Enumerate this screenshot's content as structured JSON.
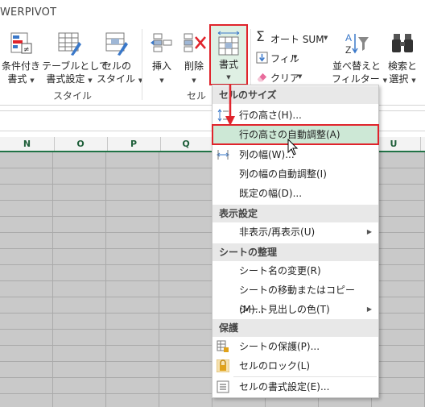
{
  "ribbon": {
    "tab_title": "WERPIVOT",
    "cond_format": {
      "line1": "条件付き",
      "line2": "書式"
    },
    "table_format": {
      "line1": "テーブルとして",
      "line2": "書式設定"
    },
    "cell_style": {
      "line1": "セルの",
      "line2": "スタイル"
    },
    "insert": "挿入",
    "delete": "削除",
    "format": "書式",
    "autosum": "オート SUM",
    "fill": "フィル",
    "clear": "クリア",
    "sort": {
      "line1": "並べ替えと",
      "line2": "フィルター"
    },
    "find": {
      "line1": "検索と",
      "line2": "選択"
    },
    "group_style": "スタイル",
    "group_cells": "セル"
  },
  "columns": [
    "N",
    "O",
    "P",
    "Q",
    "U"
  ],
  "menu": {
    "sec_size": "セルのサイズ",
    "row_height": "行の高さ(H)...",
    "autofit_row": "行の高さの自動調整(A)",
    "col_width": "列の幅(W)...",
    "autofit_col": "列の幅の自動調整(I)",
    "default_width": "既定の幅(D)...",
    "sec_visibility": "表示設定",
    "hide_unhide": "非表示/再表示(U)",
    "sec_organize": "シートの整理",
    "rename_sheet": "シート名の変更(R)",
    "move_copy": "シートの移動またはコピー(M)...",
    "tab_color": "シート見出しの色(T)",
    "sec_protect": "保護",
    "protect_sheet": "シートの保護(P)...",
    "lock_cell": "セルのロック(L)",
    "format_cells": "セルの書式設定(E)..."
  },
  "colors": {
    "accent_green": "#217346",
    "highlight": "#cde8d6",
    "callout_red": "#e0242c"
  }
}
